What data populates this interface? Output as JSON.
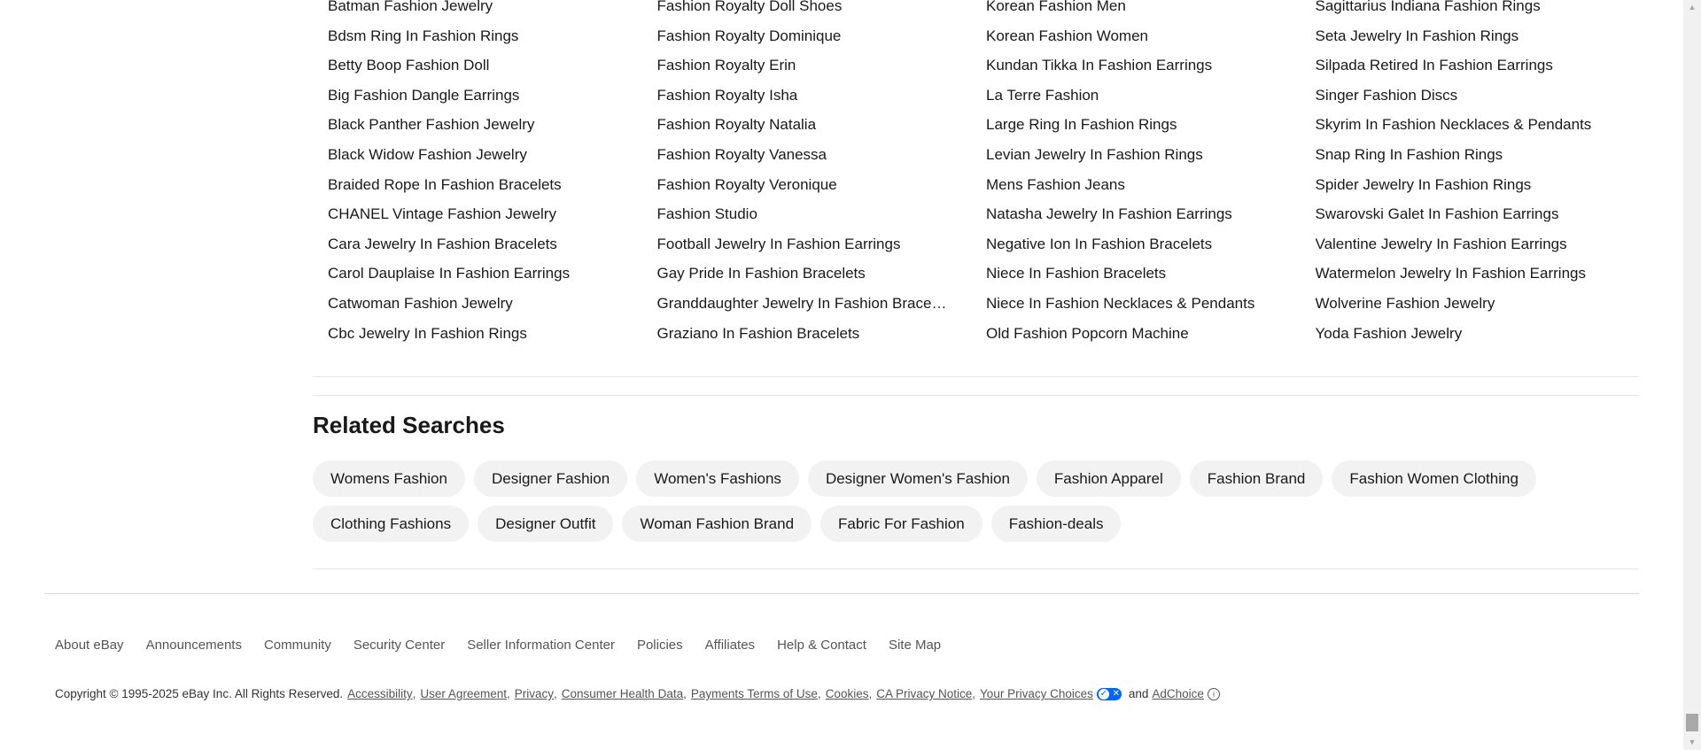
{
  "link_columns": [
    [
      "Batman Fashion Jewelry",
      "Bdsm Ring In Fashion Rings",
      "Betty Boop Fashion Doll",
      "Big Fashion Dangle Earrings",
      "Black Panther Fashion Jewelry",
      "Black Widow Fashion Jewelry",
      "Braided Rope In Fashion Bracelets",
      "CHANEL Vintage Fashion Jewelry",
      "Cara Jewelry In Fashion Bracelets",
      "Carol Dauplaise In Fashion Earrings",
      "Catwoman Fashion Jewelry",
      "Cbc Jewelry In Fashion Rings"
    ],
    [
      "Fashion Royalty Doll Shoes",
      "Fashion Royalty Dominique",
      "Fashion Royalty Erin",
      "Fashion Royalty Isha",
      "Fashion Royalty Natalia",
      "Fashion Royalty Vanessa",
      "Fashion Royalty Veronique",
      "Fashion Studio",
      "Football Jewelry In Fashion Earrings",
      "Gay Pride In Fashion Bracelets",
      "Granddaughter Jewelry In Fashion Bracelets",
      "Graziano In Fashion Bracelets"
    ],
    [
      "Korean Fashion Men",
      "Korean Fashion Women",
      "Kundan Tikka In Fashion Earrings",
      "La Terre Fashion",
      "Large Ring In Fashion Rings",
      "Levian Jewelry In Fashion Rings",
      "Mens Fashion Jeans",
      "Natasha Jewelry In Fashion Earrings",
      "Negative Ion In Fashion Bracelets",
      "Niece In Fashion Bracelets",
      "Niece In Fashion Necklaces & Pendants",
      "Old Fashion Popcorn Machine"
    ],
    [
      "Sagittarius Indiana Fashion Rings",
      "Seta Jewelry In Fashion Rings",
      "Silpada Retired In Fashion Earrings",
      "Singer Fashion Discs",
      "Skyrim In Fashion Necklaces & Pendants",
      "Snap Ring In Fashion Rings",
      "Spider Jewelry In Fashion Rings",
      "Swarovski Galet In Fashion Earrings",
      "Valentine Jewelry In Fashion Earrings",
      "Watermelon Jewelry In Fashion Earrings",
      "Wolverine Fashion Jewelry",
      "Yoda Fashion Jewelry"
    ]
  ],
  "related": {
    "title": "Related Searches",
    "chips": [
      "Womens Fashion",
      "Designer Fashion",
      "Women's Fashions",
      "Designer Women's Fashion",
      "Fashion Apparel",
      "Fashion Brand",
      "Fashion Women Clothing",
      "Clothing Fashions",
      "Designer Outfit",
      "Woman Fashion Brand",
      "Fabric For Fashion",
      "Fashion-deals"
    ]
  },
  "footer": {
    "nav": [
      "About eBay",
      "Announcements",
      "Community",
      "Security Center",
      "Seller Information Center",
      "Policies",
      "Affiliates",
      "Help & Contact",
      "Site Map"
    ],
    "copyright_text": "Copyright © 1995-2025 eBay Inc. All Rights Reserved.",
    "legal_links": [
      "Accessibility",
      "User Agreement",
      "Privacy",
      "Consumer Health Data",
      "Payments Terms of Use",
      "Cookies",
      "CA Privacy Notice",
      "Your Privacy Choices"
    ],
    "and_text": "and",
    "adchoice": "AdChoice"
  }
}
